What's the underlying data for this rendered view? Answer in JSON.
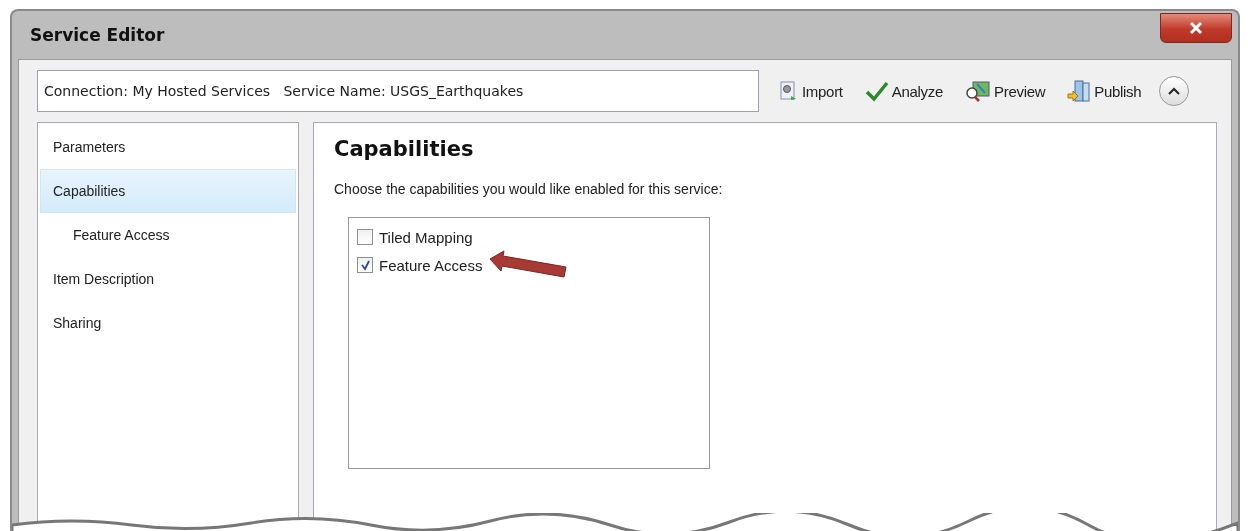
{
  "window": {
    "title": "Service Editor"
  },
  "connection_field": {
    "value": "Connection: My Hosted Services   Service Name: USGS_Earthquakes"
  },
  "toolbar": [
    {
      "kind": "import",
      "label": "Import"
    },
    {
      "kind": "analyze",
      "label": "Analyze"
    },
    {
      "kind": "preview",
      "label": "Preview"
    },
    {
      "kind": "publish",
      "label": "Publish"
    }
  ],
  "sidebar": {
    "items": [
      {
        "label": "Parameters",
        "selected": false
      },
      {
        "label": "Capabilities",
        "selected": true,
        "children": [
          {
            "label": "Feature Access",
            "selected": false
          }
        ]
      },
      {
        "label": "Item Description",
        "selected": false
      },
      {
        "label": "Sharing",
        "selected": false
      }
    ]
  },
  "content": {
    "heading": "Capabilities",
    "instruction": "Choose the capabilities you would like enabled for this service:",
    "capabilities": [
      {
        "label": "Tiled Mapping",
        "checked": false
      },
      {
        "label": "Feature Access",
        "checked": true
      }
    ]
  }
}
